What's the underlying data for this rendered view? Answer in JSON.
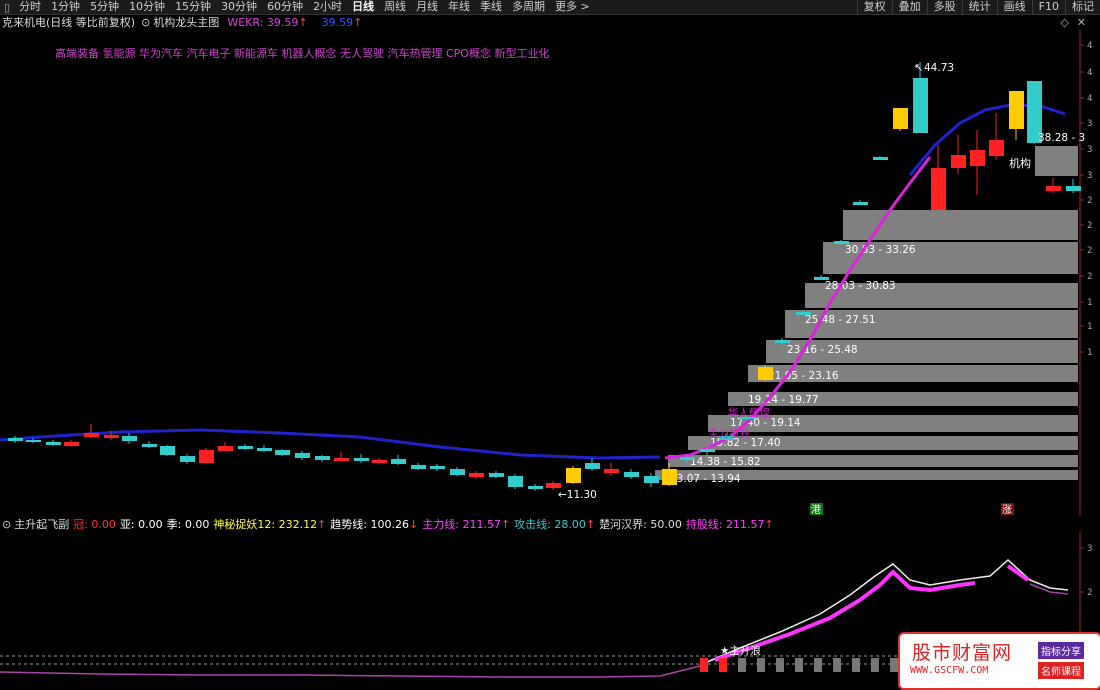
{
  "toolbar": {
    "items": [
      "分时",
      "1分钟",
      "5分钟",
      "10分钟",
      "15分钟",
      "30分钟",
      "60分钟",
      "2小时",
      "日线",
      "周线",
      "月线",
      "年线",
      "季线",
      "多周期",
      "更多 >"
    ],
    "active": "日线",
    "right_buttons": [
      "复权",
      "叠加",
      "多股",
      "统计",
      "画线",
      "F10",
      "标记"
    ]
  },
  "title": {
    "stock": "克来机电(日线 等比前复权)",
    "indicator": "机构龙头主图",
    "wekr_label": "WEKR: 39.59",
    "wekr_value": "39.59"
  },
  "concepts": "高端装备 氢能源 华为汽车 汽车电子 新能源车 机器人概念 无人驾驶 汽车热管理 CPO概念 新型工业化",
  "main_chart": {
    "high_label": "44.73",
    "low_label": "11.30",
    "jigou_label": "机构",
    "cut_label": "38.28 - 3",
    "y_axis_labels": [
      "4",
      "4",
      "4",
      "3",
      "3",
      "3",
      "2",
      "2",
      "2",
      "2",
      "1",
      "1",
      "1"
    ],
    "purple_label_1": "华人辉煌",
    "purple_label_2": "主力拉升",
    "zones": [
      {
        "label": "13.07 - 13.94"
      },
      {
        "label": "14.38 - 15.82"
      },
      {
        "label": "15.82 - 17.40"
      },
      {
        "label": "17.40 - 19.14"
      },
      {
        "label": "19.14 - 19.77"
      },
      {
        "label": "21.05 - 23.16"
      },
      {
        "label": "23.16 - 25.48"
      },
      {
        "label": "25.48 - 27.51"
      },
      {
        "label": "28.03 - 30.83"
      },
      {
        "label": "30.83 - 33.26"
      }
    ],
    "markers": {
      "gang": "港",
      "zhang": "涨"
    }
  },
  "sub_chart": {
    "title": "主升起飞副",
    "fields": [
      {
        "label": "冠:",
        "value": "0.00",
        "color": "#ff3333"
      },
      {
        "label": "亚:",
        "value": "0.00",
        "color": "#ffffff"
      },
      {
        "label": "季:",
        "value": "0.00",
        "color": "#ffffff"
      },
      {
        "label": "神秘捉妖12:",
        "value": "232.12",
        "color": "#ffff44"
      },
      {
        "label": "趋势线:",
        "value": "100.26",
        "color": "#ffffff"
      },
      {
        "label": "主力线:",
        "value": "211.57",
        "color": "#ff44ff"
      },
      {
        "label": "攻击线:",
        "value": "28.00",
        "color": "#33cccc"
      },
      {
        "label": "楚河汉界:",
        "value": "50.00",
        "color": "#dddddd"
      },
      {
        "label": "持股线:",
        "value": "211.57",
        "color": "#ff44ff"
      }
    ],
    "zhusheng_label": "★主升浪",
    "y_axis_labels": [
      "3",
      "2"
    ]
  },
  "watermark": {
    "title": "股市财富网",
    "url": "WWW.GSCFW.COM",
    "tag1": "指标分享",
    "tag2": "名师课程"
  },
  "colors": {
    "up": "#ff2222",
    "down": "#33cccc",
    "yellow": "#ffcc00",
    "ma": "#2222cc",
    "purple": "#dd22dd",
    "zone": "#808080"
  }
}
